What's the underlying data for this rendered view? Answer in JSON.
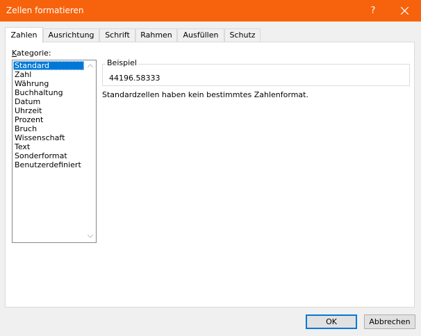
{
  "dialog": {
    "title": "Zellen formatieren",
    "help_label": "?",
    "close_icon": "close-icon",
    "accent_color": "#f7630c"
  },
  "tabs": [
    {
      "label": "Zahlen",
      "active": true
    },
    {
      "label": "Ausrichtung",
      "active": false
    },
    {
      "label": "Schrift",
      "active": false
    },
    {
      "label": "Rahmen",
      "active": false
    },
    {
      "label": "Ausfüllen",
      "active": false
    },
    {
      "label": "Schutz",
      "active": false
    }
  ],
  "category": {
    "label_prefix": "K",
    "label_rest": "ategorie:",
    "selected": "Standard",
    "items": [
      "Standard",
      "Zahl",
      "Währung",
      "Buchhaltung",
      "Datum",
      "Uhrzeit",
      "Prozent",
      "Bruch",
      "Wissenschaft",
      "Text",
      "Sonderformat",
      "Benutzerdefiniert"
    ]
  },
  "sample": {
    "legend": "Beispiel",
    "value": "44196.58333"
  },
  "description": "Standardzellen haben kein bestimmtes Zahlenformat.",
  "buttons": {
    "ok": "OK",
    "cancel": "Abbrechen"
  }
}
